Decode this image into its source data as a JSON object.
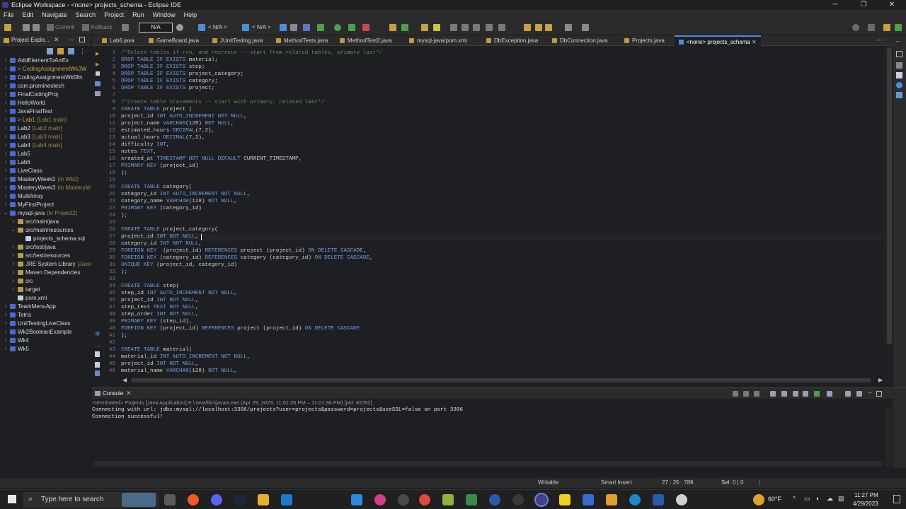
{
  "window": {
    "title": "Eclipse Workspace - <none> projects_schema - Eclipse IDE"
  },
  "menu": [
    "File",
    "Edit",
    "Navigate",
    "Search",
    "Project",
    "Run",
    "Window",
    "Help"
  ],
  "toolbar": {
    "commit": "Commit",
    "rollback": "Rollback",
    "profile": "N/A",
    "combo1": "< N/A >",
    "combo2": "< N/A >"
  },
  "explorer": {
    "tab_label": "Project Explo...",
    "items": [
      {
        "label": "AddElementToArrEx",
        "sub": "",
        "indent": 0,
        "arrow": ">"
      },
      {
        "label": "> CodingAssignmentWk3W",
        "sub": "",
        "indent": 0,
        "arrow": ">",
        "mod": true
      },
      {
        "label": "CodingAssignmentWk5fin",
        "sub": "",
        "indent": 0,
        "arrow": ">"
      },
      {
        "label": "com.promineotech",
        "sub": "",
        "indent": 0,
        "arrow": ">"
      },
      {
        "label": "FinalCodingProj",
        "sub": "",
        "indent": 0,
        "arrow": ">"
      },
      {
        "label": "HelloWorld",
        "sub": "",
        "indent": 0,
        "arrow": ">"
      },
      {
        "label": "JavaFinalTest",
        "sub": "",
        "indent": 0,
        "arrow": ">"
      },
      {
        "label": "> Lab1",
        "sub": "[Lab1 main]",
        "indent": 0,
        "arrow": ">",
        "mod": true
      },
      {
        "label": "Lab2",
        "sub": "[Lab2 main]",
        "indent": 0,
        "arrow": ">"
      },
      {
        "label": "Lab3",
        "sub": "[Lab3 main]",
        "indent": 0,
        "arrow": ">"
      },
      {
        "label": "Lab4",
        "sub": "[Lab4 main]",
        "indent": 0,
        "arrow": ">"
      },
      {
        "label": "Lab5",
        "sub": "",
        "indent": 0,
        "arrow": ">"
      },
      {
        "label": "Lab6",
        "sub": "",
        "indent": 0,
        "arrow": ">"
      },
      {
        "label": "LiveClass",
        "sub": "",
        "indent": 0,
        "arrow": ">"
      },
      {
        "label": "MasteryWeek2",
        "sub": "(in Wk2)",
        "indent": 0,
        "arrow": ">"
      },
      {
        "label": "MasteryWeek3",
        "sub": "(in MasteryW",
        "indent": 0,
        "arrow": ">"
      },
      {
        "label": "MultiArray",
        "sub": "",
        "indent": 0,
        "arrow": ">"
      },
      {
        "label": "MyFirstProject",
        "sub": "",
        "indent": 0,
        "arrow": ">"
      },
      {
        "label": "mysql-java",
        "sub": "(in Project2)",
        "indent": 0,
        "arrow": "v"
      },
      {
        "label": "src/main/java",
        "sub": "",
        "indent": 1,
        "arrow": ">"
      },
      {
        "label": "src/main/resources",
        "sub": "",
        "indent": 1,
        "arrow": "v"
      },
      {
        "label": "projects_schema.sql",
        "sub": "",
        "indent": 2,
        "arrow": ""
      },
      {
        "label": "src/test/java",
        "sub": "",
        "indent": 1,
        "arrow": ">"
      },
      {
        "label": "src/test/resources",
        "sub": "",
        "indent": 1,
        "arrow": ">"
      },
      {
        "label": "JRE System Library",
        "sub": "[JavaS",
        "indent": 1,
        "arrow": ">"
      },
      {
        "label": "Maven Dependencies",
        "sub": "",
        "indent": 1,
        "arrow": ">"
      },
      {
        "label": "src",
        "sub": "",
        "indent": 1,
        "arrow": ">"
      },
      {
        "label": "target",
        "sub": "",
        "indent": 1,
        "arrow": ">"
      },
      {
        "label": "pom.xml",
        "sub": "",
        "indent": 1,
        "arrow": ""
      },
      {
        "label": "TeamMenuApp",
        "sub": "",
        "indent": 0,
        "arrow": ">"
      },
      {
        "label": "Tetris",
        "sub": "",
        "indent": 0,
        "arrow": ">"
      },
      {
        "label": "UnitTestingLiveClass",
        "sub": "",
        "indent": 0,
        "arrow": ">"
      },
      {
        "label": "Wk2BooleanExample",
        "sub": "",
        "indent": 0,
        "arrow": ">"
      },
      {
        "label": "Wk4",
        "sub": "",
        "indent": 0,
        "arrow": ">"
      },
      {
        "label": "Wk5",
        "sub": "",
        "indent": 0,
        "arrow": ">"
      }
    ]
  },
  "editor_tabs": [
    {
      "label": "Lab6.java"
    },
    {
      "label": "GameBoard.java"
    },
    {
      "label": "JUnitTesting.java"
    },
    {
      "label": "MethodTests.java"
    },
    {
      "label": "MethodTest2.java"
    },
    {
      "label": "mysql-java/pom.xml"
    },
    {
      "label": "DbException.java"
    },
    {
      "label": "DbConnection.java"
    },
    {
      "label": "Projects.java"
    },
    {
      "label": "<none> projects_schema",
      "active": true
    }
  ],
  "code_lines": [
    {
      "n": "1",
      "t": "/*Delete tables if run, and recreate -- start from related tables, primary last*/"
    },
    {
      "n": "2",
      "t": "DROP TABLE IF EXISTS material;"
    },
    {
      "n": "3",
      "t": "DROP TABLE IF EXISTS step;"
    },
    {
      "n": "4",
      "t": "DROP TABLE IF EXISTS project_category;"
    },
    {
      "n": "5",
      "t": "DROP TABLE IF EXISTS category;"
    },
    {
      "n": "6",
      "t": "DROP TABLE IF EXISTS project;"
    },
    {
      "n": "7",
      "t": ""
    },
    {
      "n": "8",
      "t": "/*Create table statements -- start with primary, related last*/"
    },
    {
      "n": "9",
      "t": "CREATE TABLE project ("
    },
    {
      "n": "10",
      "t": "project_id INT AUTO_INCREMENT NOT NULL,"
    },
    {
      "n": "11",
      "t": "project_name VARCHAR(128) NOT NULL,"
    },
    {
      "n": "12",
      "t": "estimated_hours DECIMAL(7,2),"
    },
    {
      "n": "13",
      "t": "actual_hours DECIMAL(7,2),"
    },
    {
      "n": "14",
      "t": "difficulty INT,"
    },
    {
      "n": "15",
      "t": "notes TEXT,"
    },
    {
      "n": "16",
      "t": "created_at TIMESTAMP NOT NULL DEFAULT CURRENT_TIMESTAMP,"
    },
    {
      "n": "17",
      "t": "PRIMARY KEY (project_id)"
    },
    {
      "n": "18",
      "t": ");"
    },
    {
      "n": "19",
      "t": ""
    },
    {
      "n": "20",
      "t": "CREATE TABLE category("
    },
    {
      "n": "21",
      "t": "category_id INT AUTO_INCREMENT NOT NULL,"
    },
    {
      "n": "22",
      "t": "category_name VARCHAR(128) NOT NULL,"
    },
    {
      "n": "23",
      "t": "PRIMARY KEY (category_id)"
    },
    {
      "n": "24",
      "t": ");"
    },
    {
      "n": "25",
      "t": ""
    },
    {
      "n": "26",
      "t": "CREATE TABLE project_category("
    },
    {
      "n": "27",
      "t": "project_id INT NOT NULL,"
    },
    {
      "n": "28",
      "t": "category_id INT NOT NULL,"
    },
    {
      "n": "29",
      "t": "FOREIGN KEY  (project_id) REFERENCES project (project_id) ON DELETE CASCADE,"
    },
    {
      "n": "30",
      "t": "FOREIGN KEY (category_id) REFERENCES category (category_id) ON DELETE CASCADE,"
    },
    {
      "n": "31",
      "t": "UNIQUE KEY (project_id, category_id)"
    },
    {
      "n": "32",
      "t": ");"
    },
    {
      "n": "33",
      "t": ""
    },
    {
      "n": "34",
      "t": "CREATE TABLE step("
    },
    {
      "n": "35",
      "t": "step_id INT AUTO_INCREMENT NOT NULL,"
    },
    {
      "n": "36",
      "t": "project_id INT NOT NULL,"
    },
    {
      "n": "37",
      "t": "step_text TEXT NOT NULL,"
    },
    {
      "n": "38",
      "t": "step_order INT NOT NULL,"
    },
    {
      "n": "39",
      "t": "PRIMARY KEY (step_id),"
    },
    {
      "n": "40",
      "t": "FOREIGN KEY (project_id) REFERENCES project (project_id) ON DELETE CASCADE"
    },
    {
      "n": "41",
      "t": ");"
    },
    {
      "n": "42",
      "t": ""
    },
    {
      "n": "43",
      "t": "CREATE TABLE material("
    },
    {
      "n": "44",
      "t": "material_id INT AUTO_INCREMENT NOT NULL,"
    },
    {
      "n": "45",
      "t": "project_id INT NOT NULL,"
    },
    {
      "n": "46",
      "t": "material_name VARCHAR(128) NOT NULL,"
    }
  ],
  "console": {
    "tab_label": "Console",
    "header": "<terminated> Projects [Java Application] E:\\Java\\bin\\javaw.exe  (Apr 29, 2023, 11:01:35 PM – 11:01:36 PM) [pid: 82292]",
    "lines": [
      "Connecting with url: jdbc:mysql://localhost:3306/projects?user=projects&password=projects&useSSL=false on port 3306",
      "Connection successful!"
    ]
  },
  "status": {
    "writable": "Writable",
    "insert": "Smart Insert",
    "position": "27 : 25 : 789",
    "selection": "Sel: 0 | 0"
  },
  "taskbar": {
    "search": "Type here to search",
    "temp": "60°F",
    "time": "11:27 PM",
    "date": "4/29/2023"
  },
  "keywords": [
    "DROP",
    "TABLE",
    "IF",
    "EXISTS",
    "CREATE",
    "INT",
    "AUTO_INCREMENT",
    "NOT",
    "NULL",
    "VARCHAR",
    "DECIMAL",
    "TEXT",
    "TIMESTAMP",
    "DEFAULT",
    "PRIMARY",
    "KEY",
    "FOREIGN",
    "REFERENCES",
    "ON",
    "DELETE",
    "CASCADE",
    "UNIQUE"
  ]
}
